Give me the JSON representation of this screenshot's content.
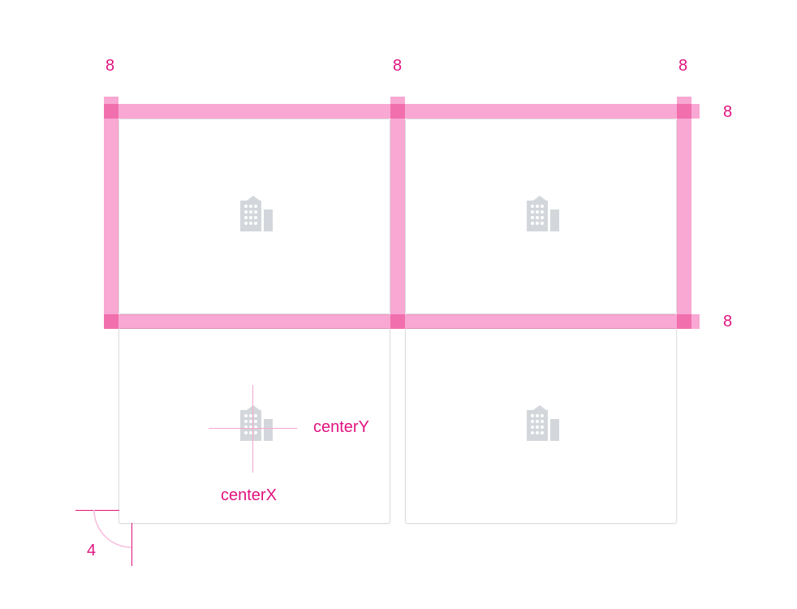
{
  "colors": {
    "accent": "#e0137f",
    "gutter": "#f472b6",
    "icon": "#d3d7dc",
    "guide": "#f3a6cd"
  },
  "labels": {
    "gutter_top_1": "8",
    "gutter_top_2": "8",
    "gutter_top_3": "8",
    "gutter_right_1": "8",
    "gutter_right_2": "8",
    "center_y": "centerY",
    "center_x": "centerX",
    "radius": "4"
  },
  "cards": [
    {
      "icon": "building-icon"
    },
    {
      "icon": "building-icon"
    },
    {
      "icon": "building-icon"
    },
    {
      "icon": "building-icon"
    }
  ]
}
